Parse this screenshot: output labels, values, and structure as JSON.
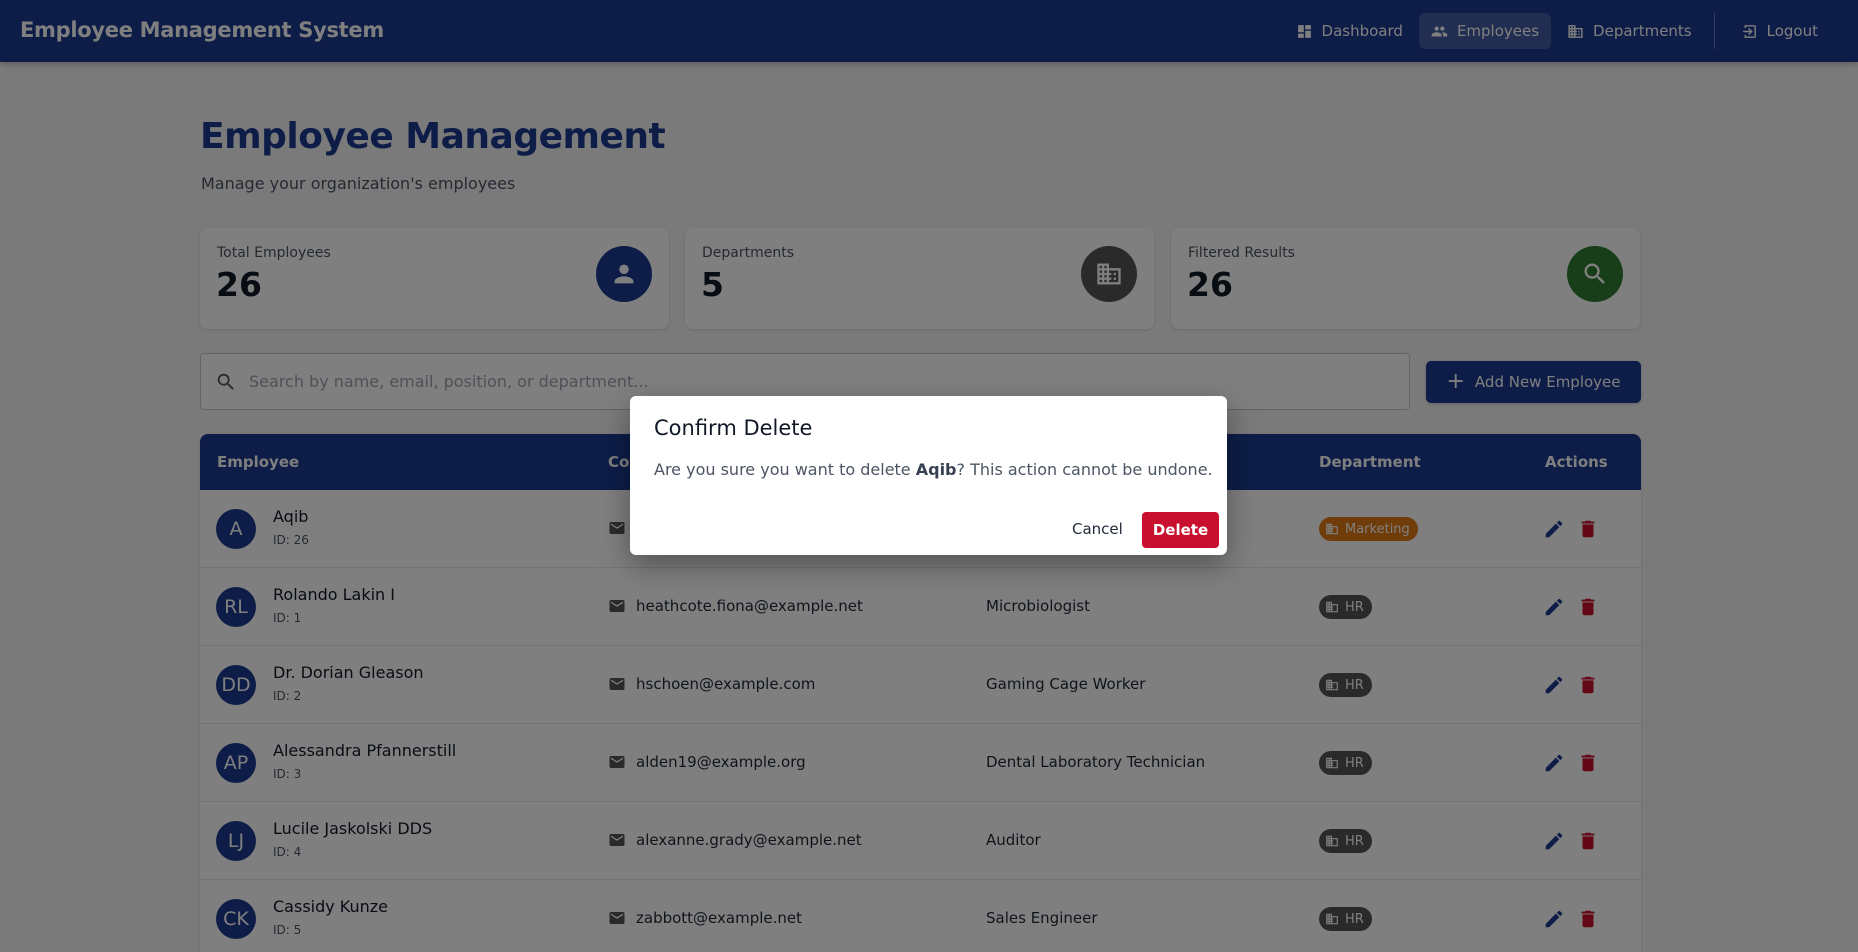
{
  "app": {
    "title": "Employee Management System"
  },
  "nav": {
    "items": [
      {
        "label": "Dashboard",
        "icon": "dashboard-icon",
        "active": false
      },
      {
        "label": "Employees",
        "icon": "people-icon",
        "active": true
      },
      {
        "label": "Departments",
        "icon": "building-icon",
        "active": false
      }
    ],
    "logout": {
      "label": "Logout",
      "icon": "logout-icon"
    }
  },
  "page": {
    "title": "Employee Management",
    "subtitle": "Manage your organization's employees"
  },
  "stats": [
    {
      "label": "Total Employees",
      "value": "26",
      "icon": "person-icon",
      "color": "#1a3a8f"
    },
    {
      "label": "Departments",
      "value": "5",
      "icon": "building-icon",
      "color": "#555555"
    },
    {
      "label": "Filtered Results",
      "value": "26",
      "icon": "search-icon",
      "color": "#2e7d32"
    }
  ],
  "search": {
    "placeholder": "Search by name, email, position, or department...",
    "value": ""
  },
  "add_button": {
    "label": "Add New Employee"
  },
  "table": {
    "headers": {
      "employee": "Employee",
      "contact": "Co",
      "department": "Department",
      "actions": "Actions"
    },
    "rows": [
      {
        "initials": "A",
        "name": "Aqib",
        "id": "ID: 26",
        "email": "",
        "position": "",
        "department": "Marketing"
      },
      {
        "initials": "RL",
        "name": "Rolando Lakin I",
        "id": "ID: 1",
        "email": "heathcote.fiona@example.net",
        "position": "Microbiologist",
        "department": "HR"
      },
      {
        "initials": "DD",
        "name": "Dr. Dorian Gleason",
        "id": "ID: 2",
        "email": "hschoen@example.com",
        "position": "Gaming Cage Worker",
        "department": "HR"
      },
      {
        "initials": "AP",
        "name": "Alessandra Pfannerstill",
        "id": "ID: 3",
        "email": "alden19@example.org",
        "position": "Dental Laboratory Technician",
        "department": "HR"
      },
      {
        "initials": "LJ",
        "name": "Lucile Jaskolski DDS",
        "id": "ID: 4",
        "email": "alexanne.grady@example.net",
        "position": "Auditor",
        "department": "HR"
      },
      {
        "initials": "CK",
        "name": "Cassidy Kunze",
        "id": "ID: 5",
        "email": "zabbott@example.net",
        "position": "Sales Engineer",
        "department": "HR"
      }
    ]
  },
  "dialog": {
    "title": "Confirm Delete",
    "message_prefix": "Are you sure you want to delete ",
    "target_name": "Aqib",
    "message_suffix": "? This action cannot be undone.",
    "cancel_label": "Cancel",
    "delete_label": "Delete"
  },
  "colors": {
    "primary": "#1a3a8f",
    "danger": "#c8102e",
    "marketing_chip": "#e07a14",
    "hr_chip": "#555555",
    "success": "#2e7d32"
  }
}
